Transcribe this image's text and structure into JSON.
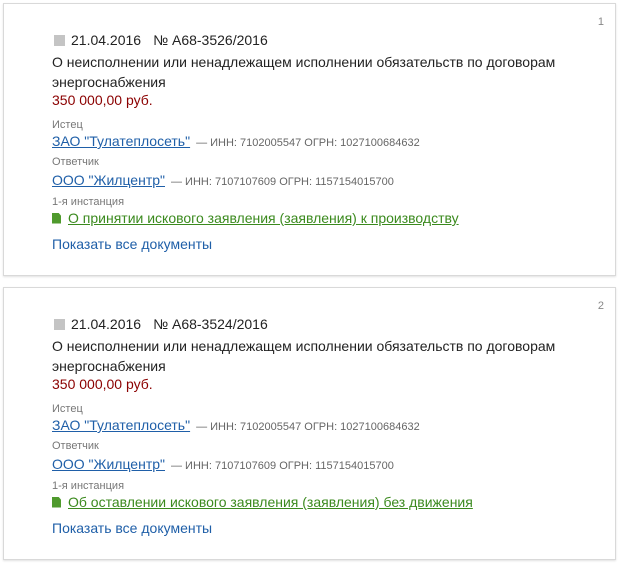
{
  "cases": [
    {
      "index": "1",
      "date": "21.04.2016",
      "number": "№ А68-3526/2016",
      "subject": "О неисполнении или ненадлежащем исполнении обязательств по договорам энергоснабжения",
      "sum": "350 000,00 руб.",
      "plaintiff_label": "Истец",
      "plaintiff_name": "ЗАО \"Тулатеплосеть\"",
      "plaintiff_details": "— ИНН: 7102005547   ОГРН: 1027100684632",
      "defendant_label": "Ответчик",
      "defendant_name": "ООО \"Жилцентр\"",
      "defendant_details": "— ИНН: 7107107609   ОГРН: 1157154015700",
      "instance_label": "1-я инстанция",
      "document": "О принятии искового заявления (заявления) к производству",
      "show_all": "Показать все документы"
    },
    {
      "index": "2",
      "date": "21.04.2016",
      "number": "№ А68-3524/2016",
      "subject": "О неисполнении или ненадлежащем исполнении обязательств по договорам энергоснабжения",
      "sum": "350 000,00 руб.",
      "plaintiff_label": "Истец",
      "plaintiff_name": "ЗАО \"Тулатеплосеть\"",
      "plaintiff_details": "— ИНН: 7102005547   ОГРН: 1027100684632",
      "defendant_label": "Ответчик",
      "defendant_name": "ООО \"Жилцентр\"",
      "defendant_details": "— ИНН: 7107107609   ОГРН: 1157154015700",
      "instance_label": "1-я инстанция",
      "document": "Об оставлении искового заявления (заявления) без движения",
      "show_all": "Показать все документы"
    }
  ]
}
